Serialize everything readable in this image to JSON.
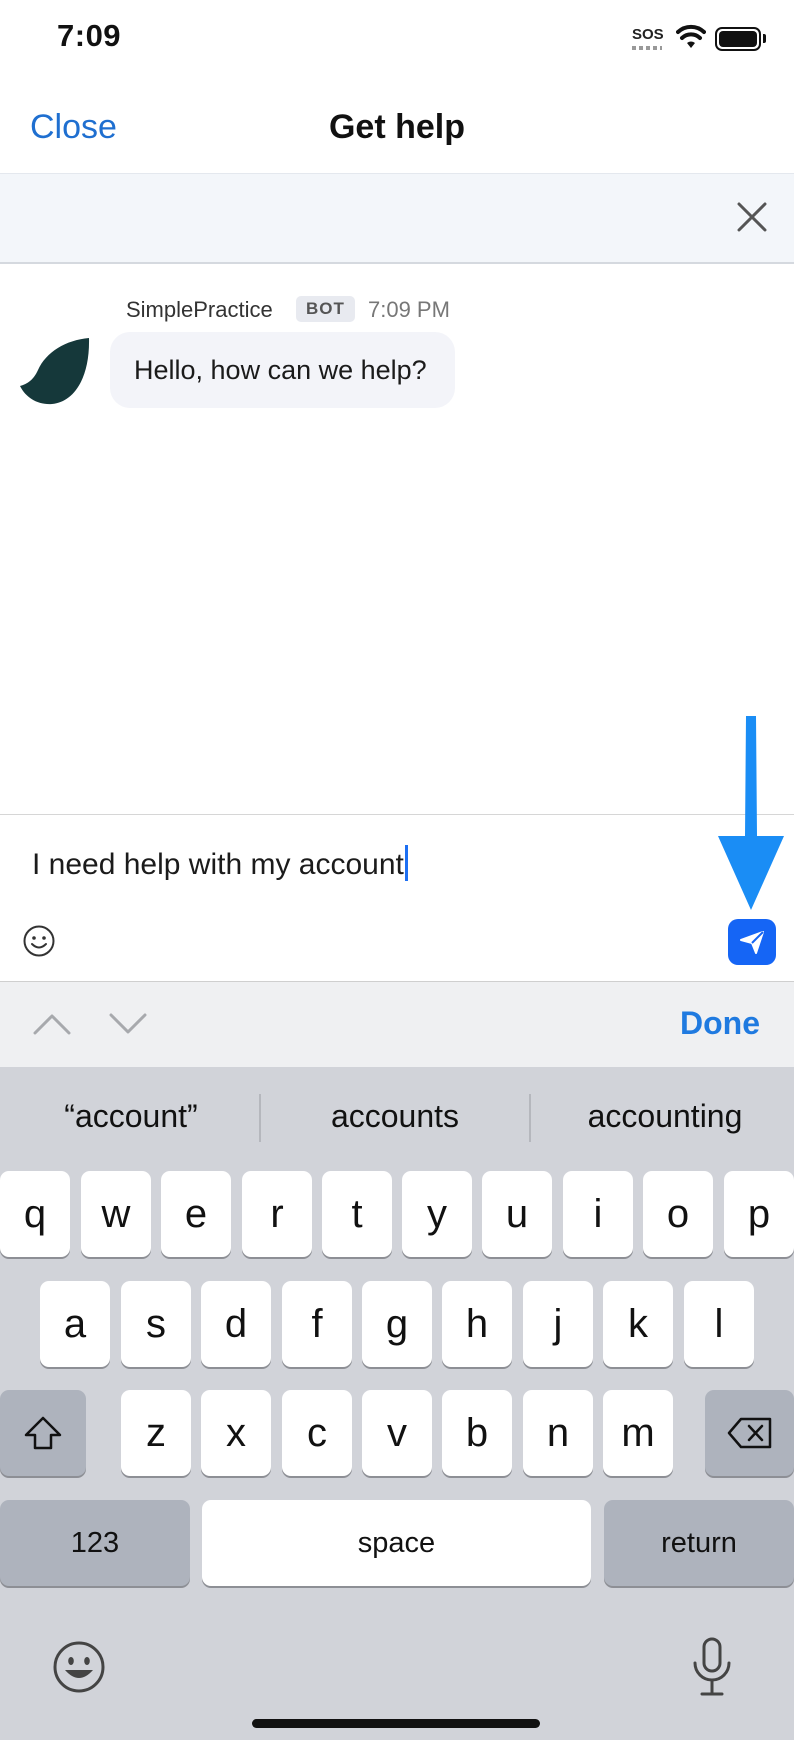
{
  "status_bar": {
    "time": "7:09",
    "sos": "SOS"
  },
  "header": {
    "close_label": "Close",
    "title": "Get help"
  },
  "chat": {
    "sender": "SimplePractice",
    "badge": "BOT",
    "time": "7:09 PM",
    "message": "Hello, how can we help?"
  },
  "composer": {
    "value": "I need help with my account"
  },
  "accessory": {
    "done_label": "Done"
  },
  "keyboard": {
    "suggestions": [
      "“account”",
      "accounts",
      "accounting"
    ],
    "row1": [
      "q",
      "w",
      "e",
      "r",
      "t",
      "y",
      "u",
      "i",
      "o",
      "p"
    ],
    "row2": [
      "a",
      "s",
      "d",
      "f",
      "g",
      "h",
      "j",
      "k",
      "l"
    ],
    "row3": [
      "z",
      "x",
      "c",
      "v",
      "b",
      "n",
      "m"
    ],
    "numbers_label": "123",
    "space_label": "space",
    "return_label": "return"
  },
  "colors": {
    "accent": "#1f6fd0",
    "send_button": "#1565f5",
    "annotation_arrow": "#1a8df5"
  }
}
